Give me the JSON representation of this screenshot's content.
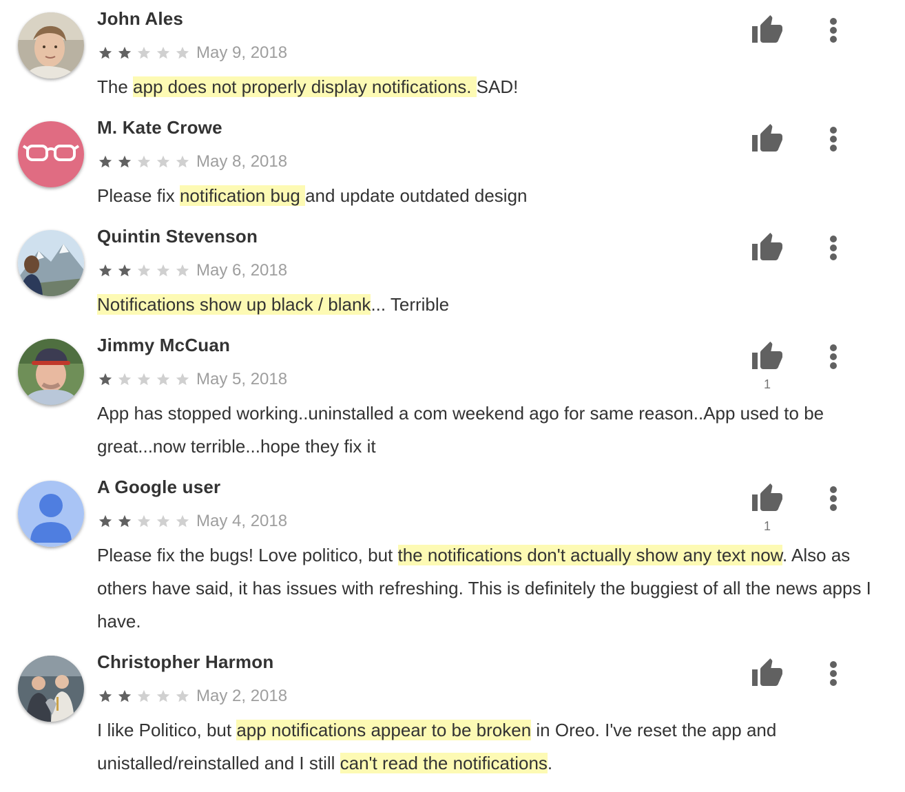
{
  "colors": {
    "highlight": "#fdfab4",
    "star_filled": "#616161",
    "star_empty": "#d0d0d0",
    "icon": "#616161"
  },
  "reviews": [
    {
      "author": "John Ales",
      "stars": 2,
      "date": "May 9, 2018",
      "avatar": "photo",
      "likes": "",
      "text": [
        {
          "t": "The ",
          "hl": false
        },
        {
          "t": "app does not properly display notifications. ",
          "hl": true
        },
        {
          "t": "SAD!",
          "hl": false
        }
      ]
    },
    {
      "author": "M. Kate Crowe",
      "stars": 2,
      "date": "May 8, 2018",
      "avatar": "glasses",
      "likes": "",
      "text": [
        {
          "t": "Please fix ",
          "hl": false
        },
        {
          "t": "notification bug ",
          "hl": true
        },
        {
          "t": "and update outdated design",
          "hl": false
        }
      ]
    },
    {
      "author": "Quintin Stevenson",
      "stars": 2,
      "date": "May 6, 2018",
      "avatar": "mountain",
      "likes": "",
      "text": [
        {
          "t": "Notifications show up black / blank",
          "hl": true
        },
        {
          "t": "... Terrible",
          "hl": false
        }
      ]
    },
    {
      "author": "Jimmy McCuan",
      "stars": 1,
      "date": "May 5, 2018",
      "avatar": "cap",
      "likes": "1",
      "text": [
        {
          "t": "App has stopped working..uninstalled a com weekend ago for same reason..App used to be great...now terrible...hope they fix it",
          "hl": false
        }
      ]
    },
    {
      "author": "A Google user",
      "stars": 2,
      "date": "May 4, 2018",
      "avatar": "generic",
      "likes": "1",
      "text": [
        {
          "t": "Please fix the bugs! Love politico, but ",
          "hl": false
        },
        {
          "t": "the notifications don't actually show any text now",
          "hl": true
        },
        {
          "t": ". Also as others have said, it has issues with refreshing. This is definitely the buggiest of all the news apps I have.",
          "hl": false
        }
      ]
    },
    {
      "author": "Christopher Harmon",
      "stars": 2,
      "date": "May 2, 2018",
      "avatar": "group",
      "likes": "",
      "text": [
        {
          "t": "I like Politico, but ",
          "hl": false
        },
        {
          "t": "app notifications appear to be broken",
          "hl": true
        },
        {
          "t": " in Oreo. I've reset the app and unistalled/reinstalled and I still ",
          "hl": false
        },
        {
          "t": "can't read the notifications",
          "hl": true
        },
        {
          "t": ".",
          "hl": false
        }
      ]
    }
  ],
  "icons": {
    "like": "thumb-up-icon",
    "more": "more-vert-icon",
    "star": "star-icon"
  }
}
